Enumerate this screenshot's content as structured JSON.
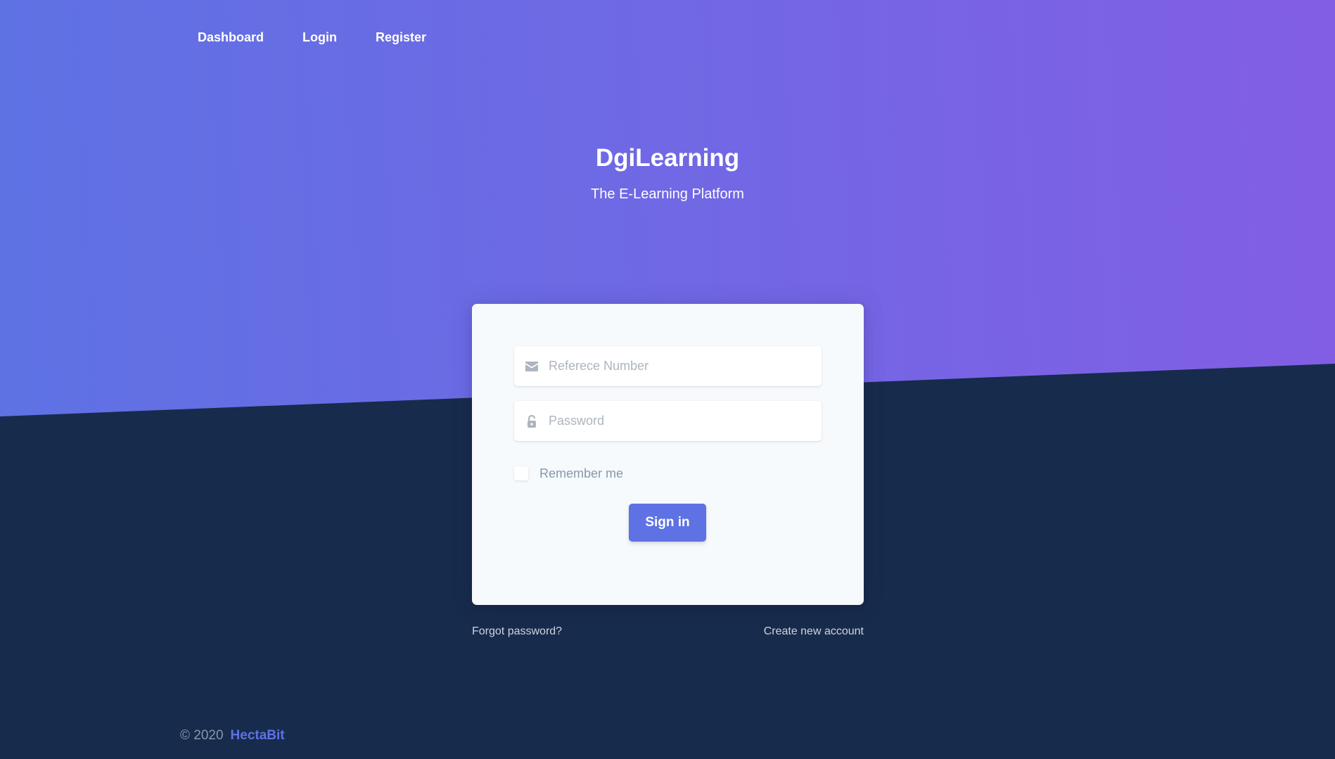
{
  "nav": {
    "items": [
      {
        "label": "Dashboard"
      },
      {
        "label": "Login"
      },
      {
        "label": "Register"
      }
    ]
  },
  "header": {
    "title": "DgiLearning",
    "subtitle": "The E-Learning Platform"
  },
  "login_form": {
    "reference_placeholder": "Referece Number",
    "reference_icon": "envelope-icon",
    "password_placeholder": "Password",
    "password_icon": "unlock-icon",
    "remember_label": "Remember me",
    "remember_checked": false,
    "submit_label": "Sign in"
  },
  "links": {
    "forgot": "Forgot password?",
    "create": "Create new account"
  },
  "footer": {
    "copyright": "© 2020",
    "company": "HectaBit"
  },
  "colors": {
    "gradient_start": "#5e72e4",
    "gradient_end": "#825ee4",
    "background": "#172b4d",
    "primary": "#5e72e4",
    "card": "#f7fafc"
  }
}
